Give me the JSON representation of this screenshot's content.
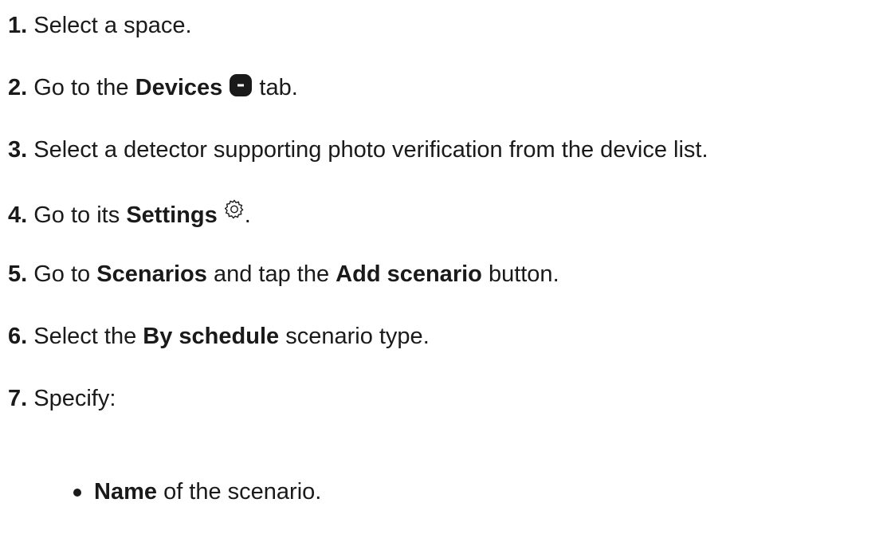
{
  "steps": [
    {
      "num": "1.",
      "parts": [
        "Select a space."
      ]
    },
    {
      "num": "2.",
      "pre": "Go to the",
      "bold": "Devices",
      "icon": "devices-tab-icon",
      "post": "tab."
    },
    {
      "num": "3.",
      "text": "Select a detector supporting photo verification from the device list."
    },
    {
      "num": "4.",
      "pre": "Go to its",
      "bold": "Settings",
      "icon": "gear-icon",
      "post": "."
    },
    {
      "num": "5.",
      "pre": "Go to",
      "bold1": "Scenarios",
      "mid": "and tap the",
      "bold2": "Add scenario",
      "post": "button."
    },
    {
      "num": "6.",
      "pre": "Select the",
      "bold": "By schedule",
      "post": "scenario type."
    },
    {
      "num": "7.",
      "text": "Specify:"
    }
  ],
  "bullets": [
    {
      "bold": "Name",
      "text": "of the scenario."
    }
  ]
}
